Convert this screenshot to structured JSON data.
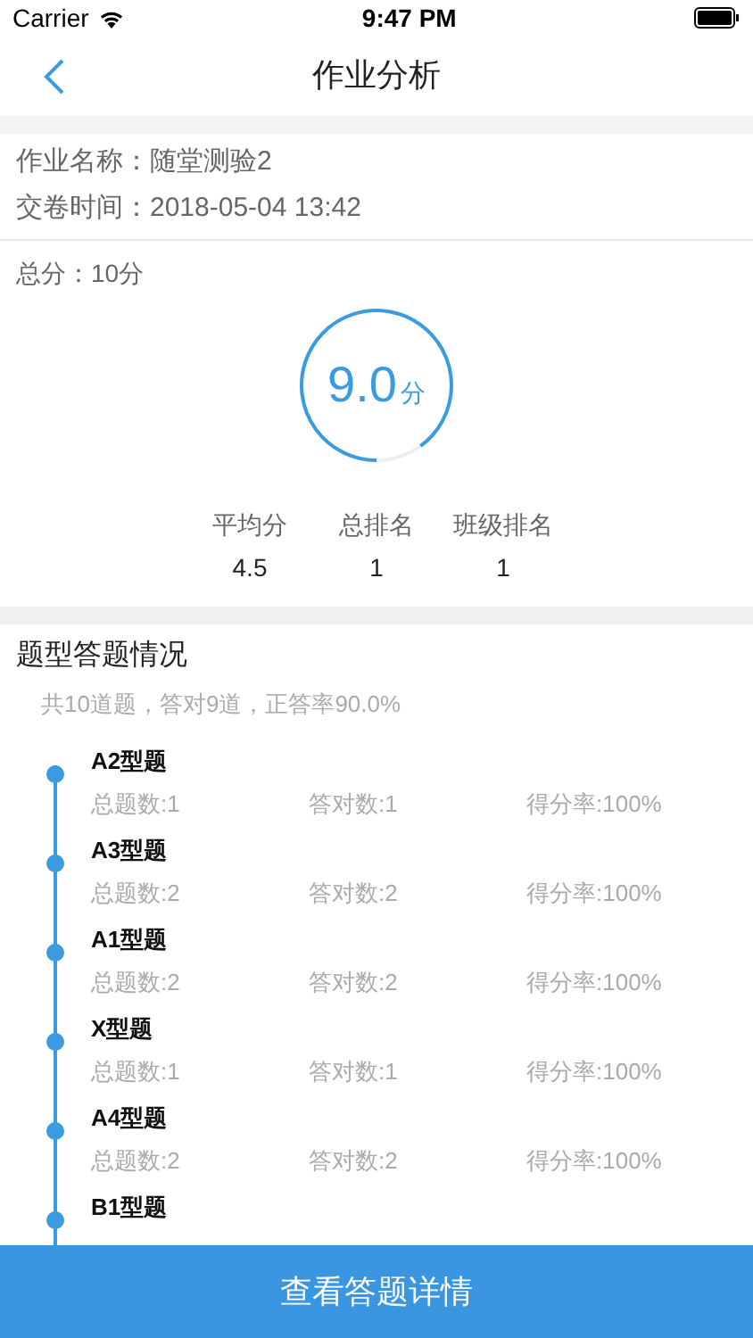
{
  "status_bar": {
    "carrier": "Carrier",
    "time": "9:47 PM"
  },
  "nav": {
    "title": "作业分析"
  },
  "info": [
    {
      "label": "作业名称：",
      "value": "随堂测验2"
    },
    {
      "label": "交卷时间：",
      "value": "2018-05-04 13:42"
    }
  ],
  "score": {
    "total": "总分：10分",
    "value": "9.0",
    "unit": "分",
    "level": 0.9
  },
  "stats": [
    {
      "label": "平均分",
      "value": "4.5"
    },
    {
      "label": "总排名",
      "value": "1"
    },
    {
      "label": "班级排名",
      "value": "1"
    }
  ],
  "breakdown": {
    "title": "题型答题情况",
    "summary": "共10道题，答对9道，正答率90.0%",
    "items": [
      {
        "name": "A2型题",
        "total": "总题数:1",
        "correct": "答对数:1",
        "rate": "得分率:100%"
      },
      {
        "name": "A3型题",
        "total": "总题数:2",
        "correct": "答对数:2",
        "rate": "得分率:100%"
      },
      {
        "name": "A1型题",
        "total": "总题数:2",
        "correct": "答对数:2",
        "rate": "得分率:100%"
      },
      {
        "name": "X型题",
        "total": "总题数:1",
        "correct": "答对数:1",
        "rate": "得分率:100%"
      },
      {
        "name": "A4型题",
        "total": "总题数:2",
        "correct": "答对数:2",
        "rate": "得分率:100%"
      },
      {
        "name": "B1型题"
      }
    ]
  },
  "button": "查看答题详情"
}
